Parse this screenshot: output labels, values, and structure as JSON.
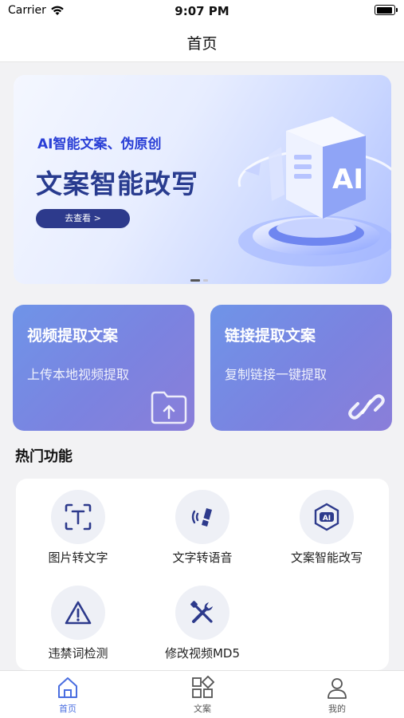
{
  "status": {
    "carrier": "Carrier",
    "time": "9:07 PM"
  },
  "nav": {
    "title": "首页"
  },
  "banner": {
    "subtitle": "AI智能文案、伪原创",
    "title": "文案智能改写",
    "button": "去查看 >",
    "art_label": "AI"
  },
  "cards": [
    {
      "title": "视频提取文案",
      "subtitle": "上传本地视频提取",
      "icon": "folder-upload-icon"
    },
    {
      "title": "链接提取文案",
      "subtitle": "复制链接一键提取",
      "icon": "link-icon"
    }
  ],
  "section": {
    "title": "热门功能"
  },
  "hot_features": [
    {
      "label": "图片转文字",
      "icon": "image-text-icon"
    },
    {
      "label": "文字转语音",
      "icon": "voice-icon"
    },
    {
      "label": "文案智能改写",
      "icon": "ai-rewrite-icon"
    },
    {
      "label": "违禁词检测",
      "icon": "warning-icon"
    },
    {
      "label": "修改视频MD5",
      "icon": "tools-icon"
    }
  ],
  "tabs": [
    {
      "label": "首页",
      "icon": "home-icon",
      "active": true
    },
    {
      "label": "文案",
      "icon": "grid-icon",
      "active": false
    },
    {
      "label": "我的",
      "icon": "user-icon",
      "active": false
    }
  ],
  "colors": {
    "accent": "#4a6ee0",
    "icon_dark": "#2d3a8c",
    "card_gradient_start": "#6f94e8",
    "card_gradient_end": "#8a7ed9"
  }
}
